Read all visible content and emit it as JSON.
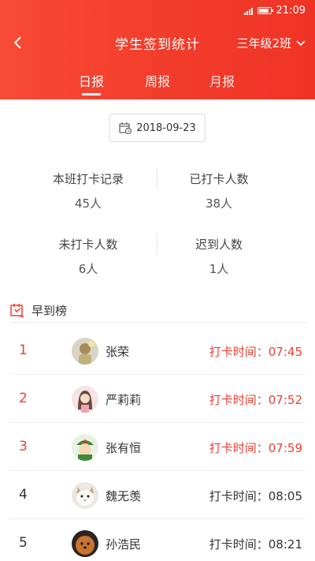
{
  "status_bar": {
    "time": "21:09"
  },
  "header": {
    "title": "学生签到统计",
    "class_selector": "三年级2班",
    "tabs": [
      {
        "label": "日报",
        "active": true
      },
      {
        "label": "周报",
        "active": false
      },
      {
        "label": "月报",
        "active": false
      }
    ]
  },
  "date_picker": {
    "value": "2018-09-23"
  },
  "stats": [
    {
      "label": "本班打卡记录",
      "value": "45人"
    },
    {
      "label": "已打卡人数",
      "value": "38人"
    },
    {
      "label": "未打卡人数",
      "value": "6人"
    },
    {
      "label": "迟到人数",
      "value": "1人"
    }
  ],
  "leaderboard": {
    "title": "早到榜",
    "rows": [
      {
        "rank": "1",
        "name": "张荣",
        "time": "打卡时间：07:45",
        "highlight": true,
        "avatar": "avatar-1"
      },
      {
        "rank": "2",
        "name": "严莉莉",
        "time": "打卡时间：07:52",
        "highlight": true,
        "avatar": "avatar-2"
      },
      {
        "rank": "3",
        "name": "张有恒",
        "time": "打卡时间：07:59",
        "highlight": true,
        "avatar": "avatar-3"
      },
      {
        "rank": "4",
        "name": "魏无羡",
        "time": "打卡时间：08:05",
        "highlight": false,
        "avatar": "avatar-4"
      },
      {
        "rank": "5",
        "name": "孙浩民",
        "time": "打卡时间：08:21",
        "highlight": false,
        "avatar": "avatar-5"
      }
    ]
  },
  "colors": {
    "accent": "#f23b2a",
    "highlight_text": "#ee4033"
  }
}
